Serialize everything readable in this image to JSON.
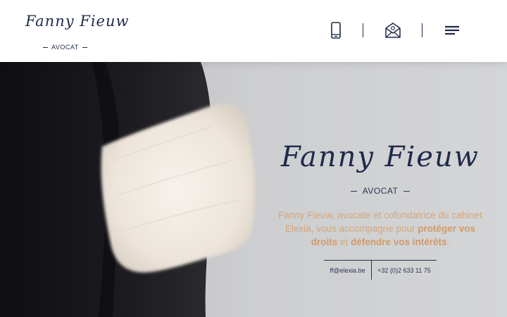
{
  "header": {
    "logo_signature": "Fanny Fieuw",
    "logo_subtitle": "AVOCAT",
    "icons": {
      "phone": "mobile-phone-icon",
      "mail": "mail-icon",
      "menu": "hamburger-menu-icon"
    }
  },
  "hero": {
    "signature": "Fanny Fieuw",
    "subtitle": "AVOCAT",
    "text_part1": "Fanny Fieuw, avocate et cofondatrice du cabinet Elexia, vous accompagne pour ",
    "text_emph1": "protéger vos droits",
    "text_part2": " et ",
    "text_emph2": "défendre vos intérêts",
    "text_part3": ".",
    "email": "ff@elexia.be",
    "phone": "+32 (0)2 633 11 75"
  },
  "colors": {
    "navy": "#1e2a4a",
    "accent": "#d29a66",
    "hero_bg": "#cfd0d2"
  }
}
